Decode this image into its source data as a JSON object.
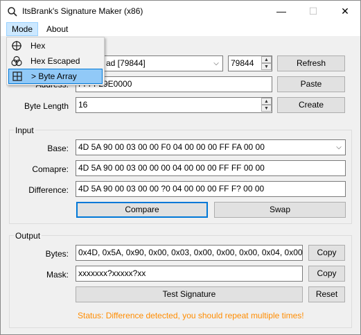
{
  "window": {
    "title": "ItsBrank's Signature Maker (x86)"
  },
  "titlebar": {
    "minimize": "—",
    "maximize": "☐",
    "close": "✕"
  },
  "menu": {
    "items": [
      {
        "label": "Mode"
      },
      {
        "label": "About"
      }
    ],
    "dropdown": [
      {
        "label": "Hex",
        "icon": "crosshair-icon"
      },
      {
        "label": "Hex Escaped",
        "icon": "venn-icon"
      },
      {
        "label": "> Byte Array",
        "icon": "grid-icon",
        "selected": true
      }
    ]
  },
  "process": {
    "combo_value": "ad [79844]",
    "pid_value": "79844",
    "refresh_label": "Refresh"
  },
  "address": {
    "label": "Address:",
    "value": "FFFF29E0000",
    "paste_label": "Paste"
  },
  "byte_length": {
    "label": "Byte Length",
    "value": "16",
    "create_label": "Create"
  },
  "input": {
    "group_label": "Input",
    "base_label": "Base:",
    "base_value": "4D 5A 90 00 03 00 00 F0 04 00 00 00 FF FA 00 00",
    "compare_label": "Comapre:",
    "compare_value": "4D 5A 90 00 03 00 00 00 04 00 00 00 FF FF 00 00",
    "difference_label": "Difference:",
    "difference_value": "4D 5A 90 00 03 00 00 ?0 04 00 00 00 FF F? 00 00",
    "compare_button": "Compare",
    "swap_button": "Swap"
  },
  "output": {
    "group_label": "Output",
    "bytes_label": "Bytes:",
    "bytes_value": "0x4D, 0x5A, 0x90, 0x00, 0x03, 0x00, 0x00, 0x00, 0x04, 0x00",
    "mask_label": "Mask:",
    "mask_value": "xxxxxxx?xxxxx?xx",
    "copy_label": "Copy",
    "test_label": "Test Signature",
    "reset_label": "Reset",
    "status": "Status: Difference detected, you should repeat multiple times!"
  },
  "colors": {
    "accent": "#0078d7",
    "status": "#ff8c00",
    "menu_highlight": "#cce8ff"
  }
}
